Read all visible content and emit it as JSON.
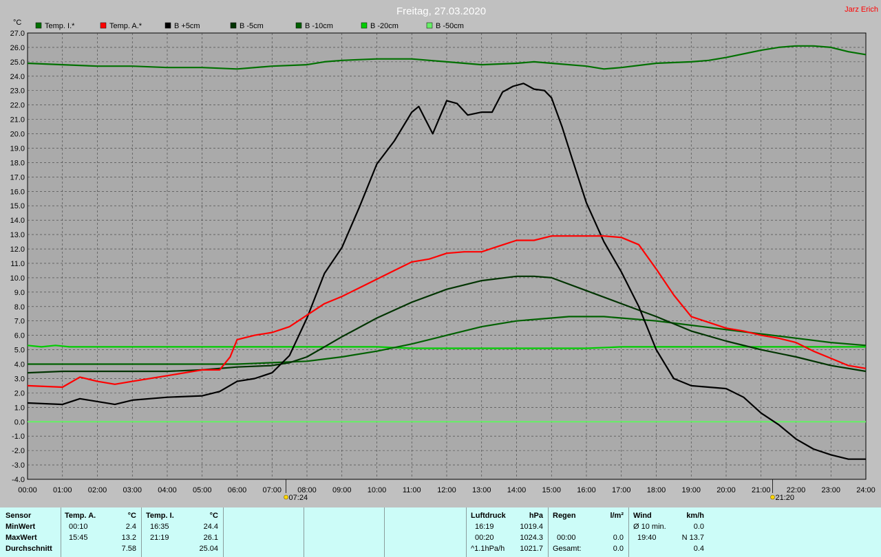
{
  "header": {
    "title": "Freitag, 27.03.2020",
    "author": "Jarz Erich"
  },
  "colors": {
    "plot_bg": "#aaaaaa",
    "grid": "#3c3c3c",
    "title": "#ffffff",
    "author": "#ff0000",
    "stats_bg": "#ccfcf8"
  },
  "chart_data": {
    "type": "line",
    "ylabel": "°C",
    "ylim": [
      -4.0,
      27.0
    ],
    "ytick_step": 1.0,
    "xlim": [
      0,
      24
    ],
    "xtick_labels": [
      "00:00",
      "01:00",
      "02:00",
      "03:00",
      "04:00",
      "05:00",
      "06:00",
      "07:00",
      "08:00",
      "09:00",
      "10:00",
      "11:00",
      "12:00",
      "13:00",
      "14:00",
      "15:00",
      "16:00",
      "17:00",
      "18:00",
      "19:00",
      "20:00",
      "21:00",
      "22:00",
      "23:00",
      "24:00"
    ],
    "grid": true,
    "legend_position": "top-left",
    "series": [
      {
        "name": "Temp. I.*",
        "color": "#007000",
        "x": [
          0,
          1,
          2,
          3,
          4,
          5,
          6,
          7,
          8,
          8.5,
          9,
          10,
          11,
          12,
          13,
          14,
          14.5,
          15,
          16,
          16.5,
          17,
          18,
          19,
          19.5,
          20,
          21,
          21.5,
          22,
          22.5,
          23,
          23.5,
          24
        ],
        "y": [
          24.9,
          24.8,
          24.7,
          24.7,
          24.6,
          24.6,
          24.5,
          24.7,
          24.8,
          25.0,
          25.1,
          25.2,
          25.2,
          25.0,
          24.8,
          24.9,
          25.0,
          24.9,
          24.7,
          24.5,
          24.6,
          24.9,
          25.0,
          25.1,
          25.3,
          25.8,
          26.0,
          26.1,
          26.1,
          26.0,
          25.7,
          25.5
        ]
      },
      {
        "name": "Temp. A.*",
        "color": "#ff0000",
        "x": [
          0,
          1,
          1.5,
          2,
          2.5,
          3,
          4,
          5,
          5.5,
          5.8,
          6,
          6.5,
          7,
          7.5,
          8,
          8.5,
          9,
          9.5,
          10,
          10.5,
          11,
          11.5,
          12,
          12.5,
          13,
          13.5,
          14,
          14.5,
          15,
          15.5,
          16,
          16.5,
          17,
          17.5,
          18,
          18.5,
          19,
          19.5,
          20,
          20.5,
          21,
          21.5,
          22,
          22.5,
          23,
          23.5,
          24
        ],
        "y": [
          2.5,
          2.4,
          3.1,
          2.8,
          2.6,
          2.8,
          3.2,
          3.6,
          3.6,
          4.5,
          5.7,
          6.0,
          6.2,
          6.6,
          7.4,
          8.2,
          8.7,
          9.3,
          9.9,
          10.5,
          11.1,
          11.3,
          11.7,
          11.8,
          11.8,
          12.2,
          12.6,
          12.6,
          12.9,
          12.9,
          12.9,
          12.9,
          12.8,
          12.3,
          10.6,
          8.8,
          7.3,
          6.9,
          6.5,
          6.3,
          6.0,
          5.8,
          5.5,
          4.9,
          4.4,
          3.9,
          3.7
        ]
      },
      {
        "name": "B +5cm",
        "color": "#000000",
        "x": [
          0,
          1,
          1.5,
          2,
          2.5,
          3,
          4,
          5,
          5.5,
          6,
          6.5,
          7,
          7.5,
          8,
          8.5,
          9,
          9.5,
          10,
          10.5,
          11,
          11.2,
          11.6,
          12,
          12.3,
          12.6,
          13,
          13.3,
          13.6,
          13.9,
          14.2,
          14.5,
          14.8,
          15,
          15.3,
          15.6,
          16,
          16.5,
          17,
          17.5,
          18,
          18.5,
          19,
          19.5,
          20,
          20.5,
          21,
          21.5,
          22,
          22.5,
          23,
          23.5,
          24
        ],
        "y": [
          1.3,
          1.2,
          1.6,
          1.4,
          1.2,
          1.5,
          1.7,
          1.8,
          2.1,
          2.8,
          3.0,
          3.4,
          4.6,
          7.2,
          10.3,
          12.1,
          14.9,
          17.9,
          19.5,
          21.5,
          21.9,
          20.0,
          22.3,
          22.1,
          21.3,
          21.5,
          21.5,
          22.9,
          23.3,
          23.5,
          23.1,
          23.0,
          22.5,
          20.5,
          18.2,
          15.2,
          12.5,
          10.4,
          8.0,
          5.0,
          3.0,
          2.5,
          2.4,
          2.3,
          1.7,
          0.6,
          -0.2,
          -1.2,
          -1.9,
          -2.3,
          -2.6,
          -2.6
        ]
      },
      {
        "name": "B -5cm",
        "color": "#003300",
        "x": [
          0,
          1,
          2,
          3,
          4,
          5,
          6,
          7,
          7.5,
          8,
          8.5,
          9,
          10,
          11,
          12,
          13,
          14,
          14.5,
          15,
          16,
          17,
          18,
          19,
          20,
          21,
          22,
          23,
          24
        ],
        "y": [
          3.4,
          3.5,
          3.5,
          3.5,
          3.5,
          3.6,
          3.8,
          3.9,
          4.1,
          4.5,
          5.2,
          5.9,
          7.2,
          8.3,
          9.2,
          9.8,
          10.1,
          10.1,
          10.0,
          9.1,
          8.2,
          7.3,
          6.3,
          5.6,
          5.0,
          4.5,
          3.9,
          3.5
        ]
      },
      {
        "name": "B -10cm",
        "color": "#006000",
        "x": [
          0,
          1,
          2,
          3,
          4,
          5,
          6,
          7,
          8,
          9,
          10,
          11,
          12,
          13,
          14,
          15,
          15.5,
          16,
          16.5,
          17,
          18,
          19,
          20,
          21,
          22,
          23,
          24
        ],
        "y": [
          4.0,
          4.0,
          4.0,
          4.0,
          4.0,
          4.0,
          4.0,
          4.1,
          4.2,
          4.5,
          4.9,
          5.4,
          6.0,
          6.6,
          7.0,
          7.2,
          7.3,
          7.3,
          7.3,
          7.2,
          7.0,
          6.7,
          6.4,
          6.1,
          5.8,
          5.5,
          5.3
        ]
      },
      {
        "name": "B -20cm",
        "color": "#00cc00",
        "x": [
          0,
          0.4,
          0.8,
          1.2,
          1.6,
          2,
          3,
          4,
          5,
          6,
          7,
          8,
          9,
          10,
          11,
          12,
          13,
          14,
          15,
          16,
          17,
          18,
          19,
          20,
          21,
          22,
          23,
          24
        ],
        "y": [
          5.3,
          5.2,
          5.3,
          5.2,
          5.2,
          5.2,
          5.2,
          5.2,
          5.2,
          5.2,
          5.2,
          5.2,
          5.2,
          5.2,
          5.1,
          5.1,
          5.1,
          5.1,
          5.1,
          5.1,
          5.2,
          5.2,
          5.2,
          5.2,
          5.2,
          5.2,
          5.2,
          5.2
        ]
      },
      {
        "name": "B -50cm",
        "color": "#66ee66",
        "x": [
          0,
          24
        ],
        "y": [
          0.0,
          0.0
        ]
      }
    ],
    "annotations": [
      {
        "label": "07:24",
        "x": 7.4
      },
      {
        "label": "21:20",
        "x": 21.33
      }
    ]
  },
  "stats": {
    "sensor": {
      "header": "Sensor",
      "rows": [
        "MinWert",
        "MaxWert",
        "Durchschnitt"
      ]
    },
    "temp_a": {
      "header": "Temp. A.",
      "unit": "°C",
      "times": [
        "00:10",
        "15:45",
        ""
      ],
      "values": [
        "2.4",
        "13.2",
        "7.58"
      ]
    },
    "temp_i": {
      "header": "Temp. I.",
      "unit": "°C",
      "times": [
        "16:35",
        "21:19",
        ""
      ],
      "values": [
        "24.4",
        "26.1",
        "25.04"
      ]
    },
    "pressure": {
      "header": "Luftdruck",
      "unit": "hPa",
      "times": [
        "16:19",
        "00:20",
        "^1.1hPa/h"
      ],
      "values": [
        "1019.4",
        "1024.3",
        "1021.7"
      ]
    },
    "rain": {
      "header": "Regen",
      "unit": "l/m²",
      "times": [
        "",
        "00:00",
        "Gesamt:"
      ],
      "values": [
        "",
        "0.0",
        "0.0"
      ]
    },
    "wind": {
      "header": "Wind",
      "unit": "km/h",
      "times": [
        "Ø 10 min.",
        "19:40",
        ""
      ],
      "values": [
        "0.0",
        "N 13.7",
        "0.4"
      ]
    }
  }
}
